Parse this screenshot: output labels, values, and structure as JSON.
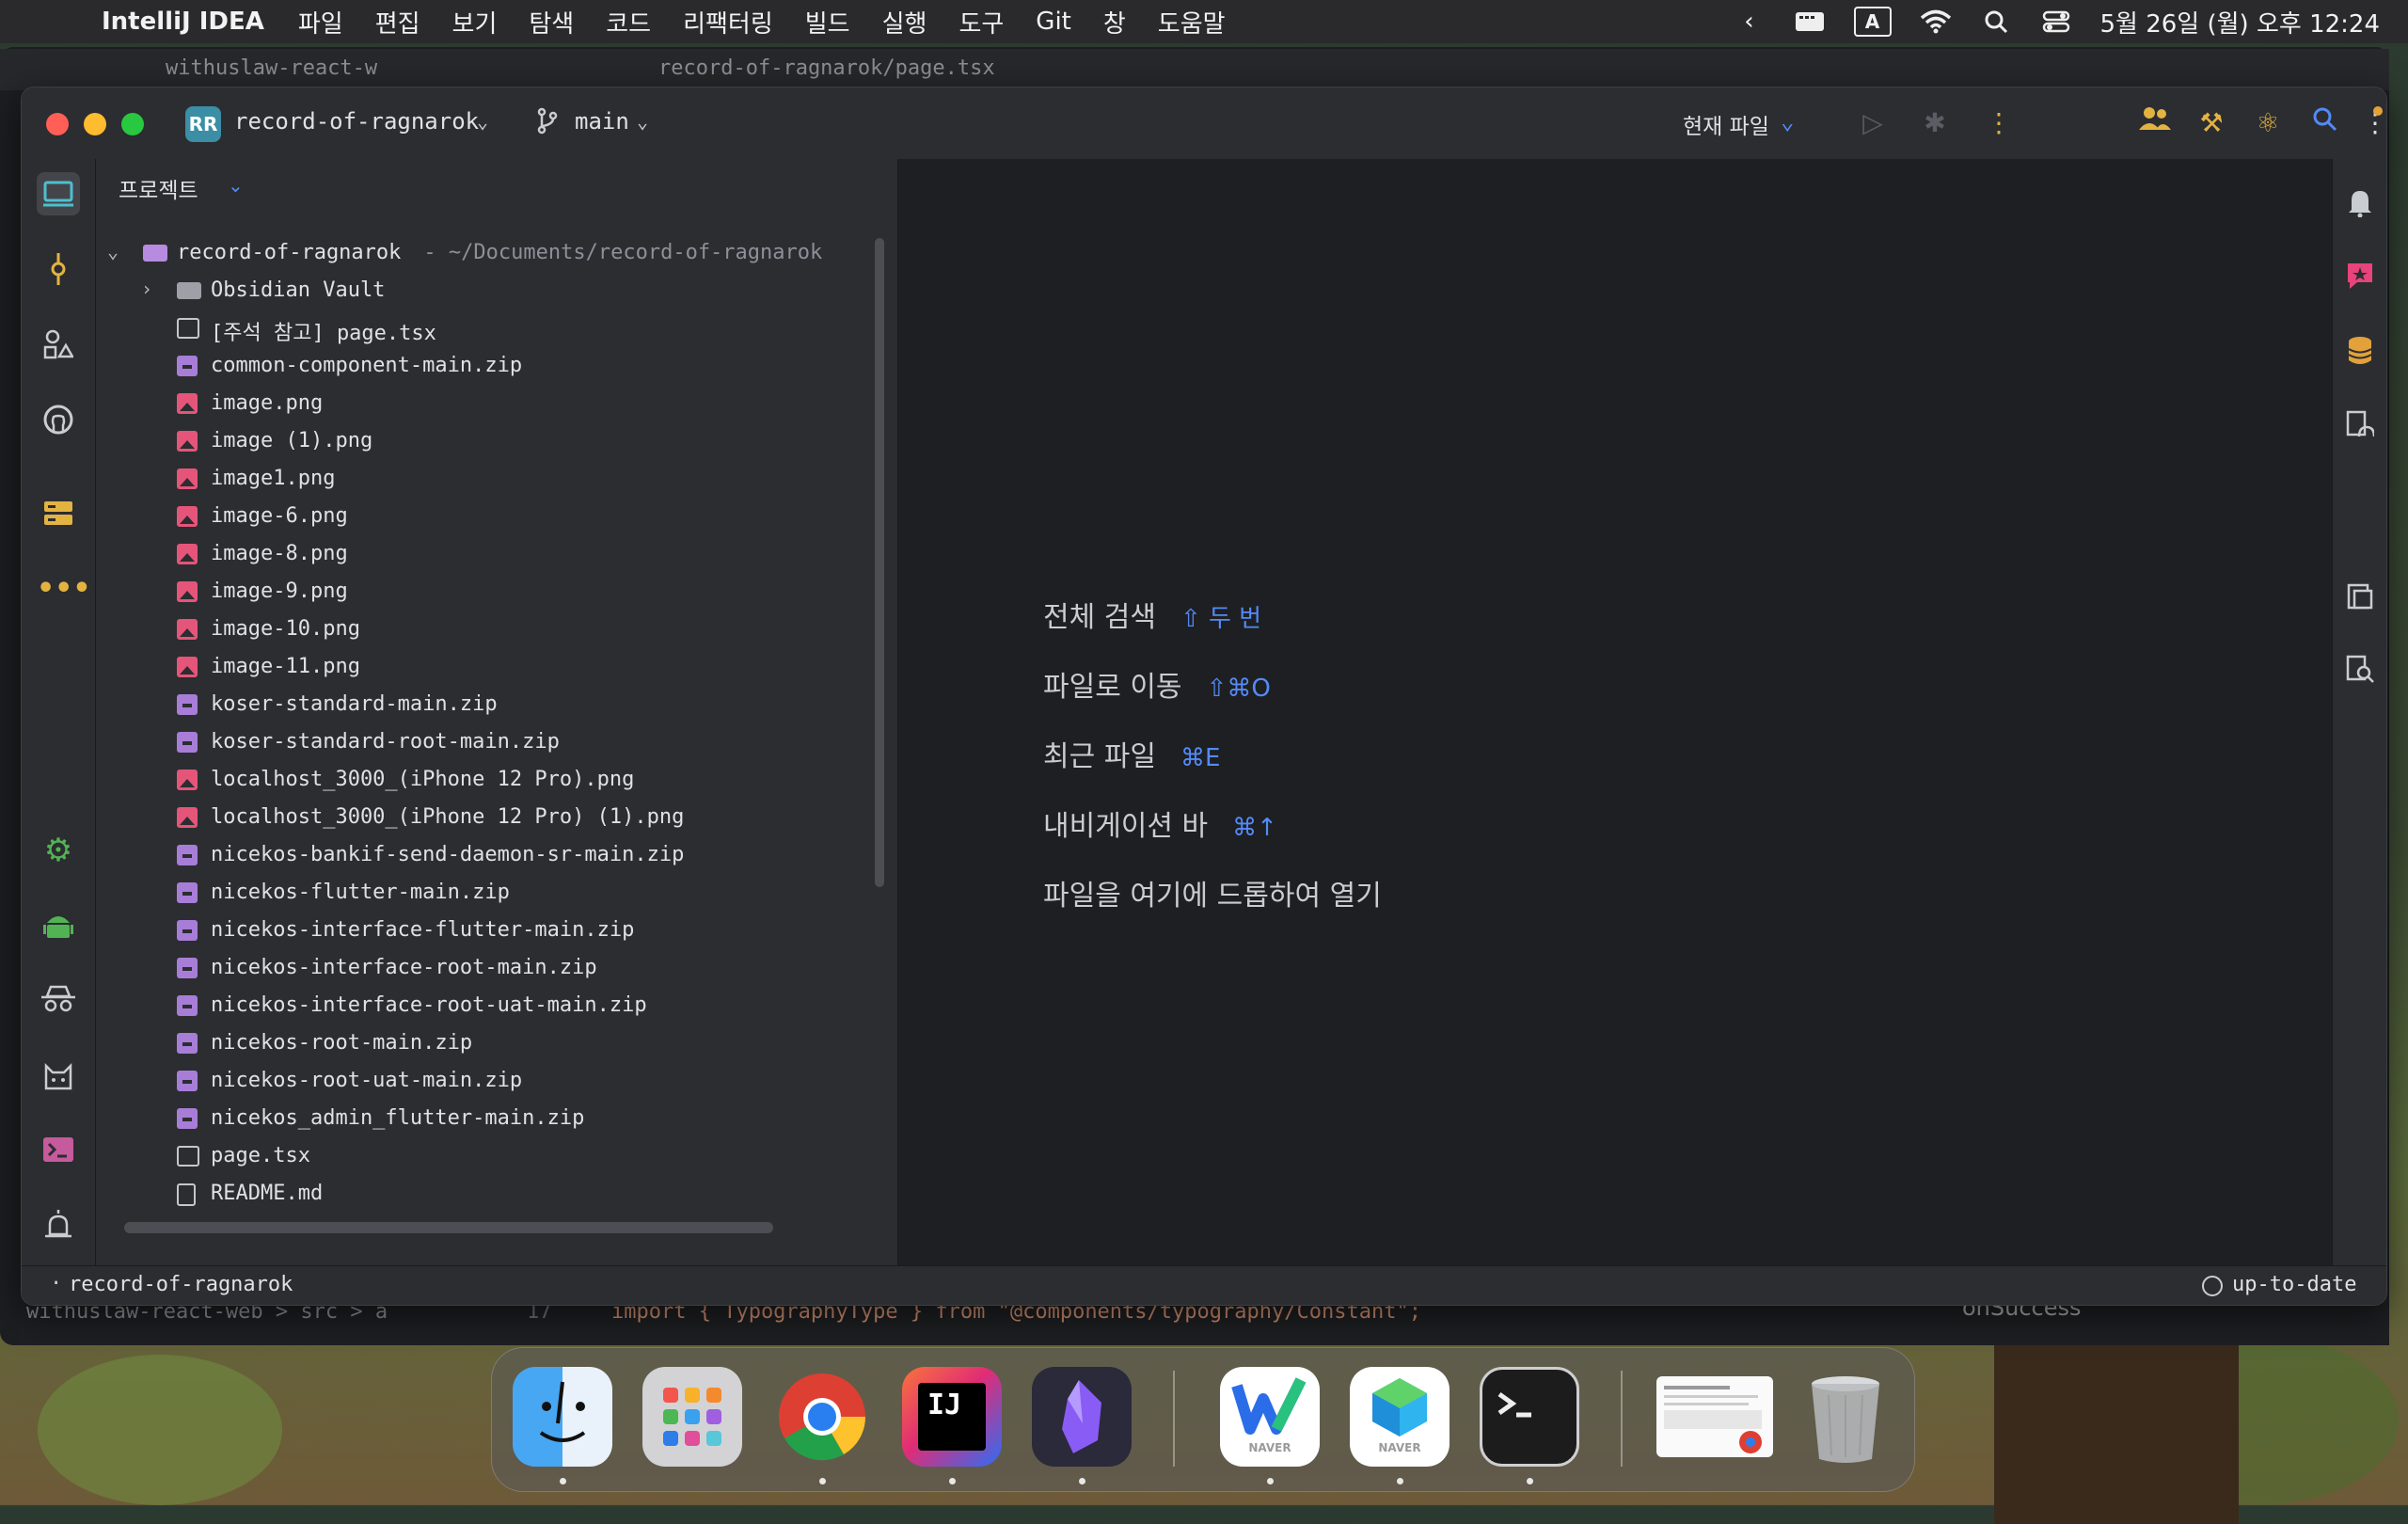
{
  "menubar": {
    "app_name": "IntelliJ IDEA",
    "items": [
      "파일",
      "편집",
      "보기",
      "탐색",
      "코드",
      "리팩터링",
      "빌드",
      "실행",
      "도구",
      "Git",
      "창",
      "도움말"
    ],
    "input_indicator": "A",
    "datetime": "5월 26일 (월) 오후 12:24"
  },
  "background": {
    "tab1": "withuslaw-react-w",
    "tab2": "record-of-ragnarok/page.tsx",
    "breadcrumb": "withuslaw-react-web  >  src  >  a",
    "code_line_no": "17",
    "code_line": "import { TypographyType } from \"@components/typography/Constant\";",
    "right_symbol": "onSuccess"
  },
  "titlebar": {
    "project_badge": "RR",
    "project_name": "record-of-ragnarok",
    "branch": "main",
    "run_config": "현재 파일"
  },
  "project_panel": {
    "header": "프로젝트",
    "root_name": "record-of-ragnarok",
    "root_path": "- ~/Documents/record-of-ragnarok",
    "items": [
      {
        "name": "Obsidian Vault",
        "type": "folder"
      },
      {
        "name": "[주석 참고] page.tsx",
        "type": "tsx"
      },
      {
        "name": "common-component-main.zip",
        "type": "zip"
      },
      {
        "name": "image.png",
        "type": "png"
      },
      {
        "name": "image (1).png",
        "type": "png"
      },
      {
        "name": "image1.png",
        "type": "png"
      },
      {
        "name": "image-6.png",
        "type": "png"
      },
      {
        "name": "image-8.png",
        "type": "png"
      },
      {
        "name": "image-9.png",
        "type": "png"
      },
      {
        "name": "image-10.png",
        "type": "png"
      },
      {
        "name": "image-11.png",
        "type": "png"
      },
      {
        "name": "koser-standard-main.zip",
        "type": "zip"
      },
      {
        "name": "koser-standard-root-main.zip",
        "type": "zip"
      },
      {
        "name": "localhost_3000_(iPhone 12 Pro).png",
        "type": "png"
      },
      {
        "name": "localhost_3000_(iPhone 12 Pro) (1).png",
        "type": "png"
      },
      {
        "name": "nicekos-bankif-send-daemon-sr-main.zip",
        "type": "zip"
      },
      {
        "name": "nicekos-flutter-main.zip",
        "type": "zip"
      },
      {
        "name": "nicekos-interface-flutter-main.zip",
        "type": "zip"
      },
      {
        "name": "nicekos-interface-root-main.zip",
        "type": "zip"
      },
      {
        "name": "nicekos-interface-root-uat-main.zip",
        "type": "zip"
      },
      {
        "name": "nicekos-root-main.zip",
        "type": "zip"
      },
      {
        "name": "nicekos-root-uat-main.zip",
        "type": "zip"
      },
      {
        "name": "nicekos_admin_flutter-main.zip",
        "type": "zip"
      },
      {
        "name": "page.tsx",
        "type": "tsx"
      },
      {
        "name": "README.md",
        "type": "md"
      }
    ]
  },
  "editor_hints": [
    {
      "label": "전체 검색",
      "shortcut": "⇧ 두 번"
    },
    {
      "label": "파일로 이동",
      "shortcut": "⇧⌘O"
    },
    {
      "label": "최근 파일",
      "shortcut": "⌘E"
    },
    {
      "label": "내비게이션 바",
      "shortcut": "⌘↑"
    },
    {
      "label": "파일을 여기에 드롭하여 열기",
      "shortcut": ""
    }
  ],
  "statusbar": {
    "project": "record-of-ragnarok",
    "vcs_status": "up-to-date"
  },
  "dock": {
    "apps": [
      "Finder",
      "Launchpad",
      "Chrome",
      "IntelliJ IDEA",
      "Obsidian",
      "Naver Whale",
      "Naver MYBOX",
      "Terminal",
      "Window Preview",
      "Trash"
    ],
    "labels": {
      "naver1": "NAVER",
      "naver2": "NAVER",
      "intellij": "IJ"
    }
  },
  "colors": {
    "accent_blue": "#548af7",
    "editor_bg": "#1e1f22",
    "panel_bg": "#2b2d30",
    "zip_icon": "#a77dd8",
    "png_icon": "#e5557a"
  }
}
